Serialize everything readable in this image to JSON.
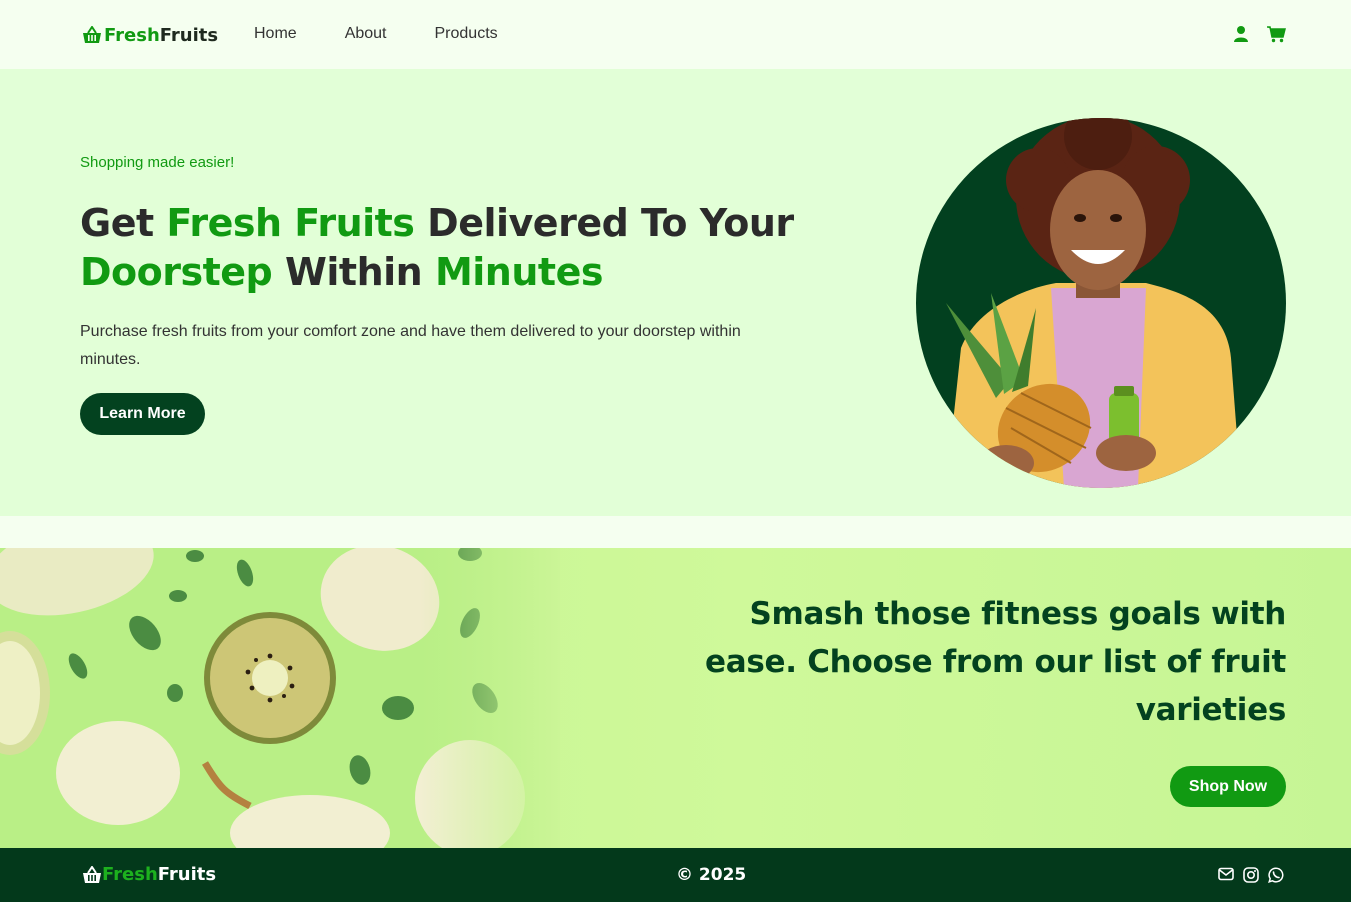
{
  "brand": {
    "fresh": "Fresh",
    "fruits": "Fruits",
    "icon": "basket-icon"
  },
  "nav": {
    "links": [
      "Home",
      "About",
      "Products"
    ],
    "icons": [
      "user-icon",
      "cart-icon"
    ]
  },
  "hero": {
    "tagline": "Shopping made easier!",
    "headline": {
      "p1": "Get ",
      "p2": "Fresh Fruits",
      "p3": " Delivered To Your ",
      "p4": "Doorstep",
      "p5": " Within ",
      "p6": "Minutes"
    },
    "description": "Purchase fresh fruits from your comfort zone and have them delivered to your doorstep within minutes.",
    "button": "Learn More"
  },
  "promo": {
    "title": "Smash those fitness goals with ease. Choose from our list of fruit varieties",
    "button": "Shop Now"
  },
  "footer": {
    "copyright": "© 2025",
    "icons": [
      "mail-icon",
      "instagram-icon",
      "whatsapp-icon"
    ]
  },
  "colors": {
    "accent": "#119a12",
    "dark": "#03421f",
    "hero_bg": "#e2ffd7",
    "promo_bg": "#cff99a",
    "footer_bg": "#03391b"
  }
}
